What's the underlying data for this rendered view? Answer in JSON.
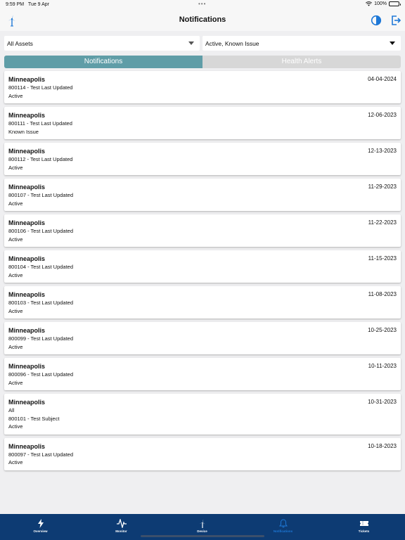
{
  "status_bar": {
    "time": "9:59 PM",
    "date": "Tue 9 Apr",
    "dots": "•••",
    "battery": "100%"
  },
  "header": {
    "title": "Notifications",
    "left_icon": "wind-turbine-icon",
    "right_icons": [
      "contrast-icon",
      "logout-icon"
    ]
  },
  "filters": {
    "asset": "All Assets",
    "status": "Active, Known Issue"
  },
  "segments": {
    "notifications": "Notifications",
    "health_alerts": "Health Alerts"
  },
  "notifications": [
    {
      "site": "Minneapolis",
      "date": "04-04-2024",
      "lines": [
        "800114 - Test Last Updated",
        "Active"
      ]
    },
    {
      "site": "Minneapolis",
      "date": "12-06-2023",
      "lines": [
        "800111 - Test Last Updated",
        "Known Issue"
      ]
    },
    {
      "site": "Minneapolis",
      "date": "12-13-2023",
      "lines": [
        "800112 - Test Last Updated",
        "Active"
      ]
    },
    {
      "site": "Minneapolis",
      "date": "11-29-2023",
      "lines": [
        "800107 - Test Last Updated",
        "Active"
      ]
    },
    {
      "site": "Minneapolis",
      "date": "11-22-2023",
      "lines": [
        "800106 - Test Last Updated",
        "Active"
      ]
    },
    {
      "site": "Minneapolis",
      "date": "11-15-2023",
      "lines": [
        "800104 - Test Last Updated",
        "Active"
      ]
    },
    {
      "site": "Minneapolis",
      "date": "11-08-2023",
      "lines": [
        "800103 - Test Last Updated",
        "Active"
      ]
    },
    {
      "site": "Minneapolis",
      "date": "10-25-2023",
      "lines": [
        "800099 - Test Last Updated",
        "Active"
      ]
    },
    {
      "site": "Minneapolis",
      "date": "10-11-2023",
      "lines": [
        "800096 - Test Last Updated",
        "Active"
      ]
    },
    {
      "site": "Minneapolis",
      "date": "10-31-2023",
      "lines": [
        "All",
        "800101 - Test Subject",
        "Active"
      ]
    },
    {
      "site": "Minneapolis",
      "date": "10-18-2023",
      "lines": [
        "800097 - Test Last Updated",
        "Active"
      ]
    }
  ],
  "tabs": [
    {
      "label": "Overview",
      "icon": "lightning-icon"
    },
    {
      "label": "Monitor",
      "icon": "waveform-icon"
    },
    {
      "label": "Device",
      "icon": "wind-turbine-icon"
    },
    {
      "label": "Notifications",
      "icon": "bell-icon"
    },
    {
      "label": "Tickets",
      "icon": "ticket-icon"
    }
  ],
  "colors": {
    "accent": "#5f9da7",
    "header_icon": "#1e78d7",
    "tab_bar": "#0d3b73",
    "active_tab": "#1e78d7"
  }
}
